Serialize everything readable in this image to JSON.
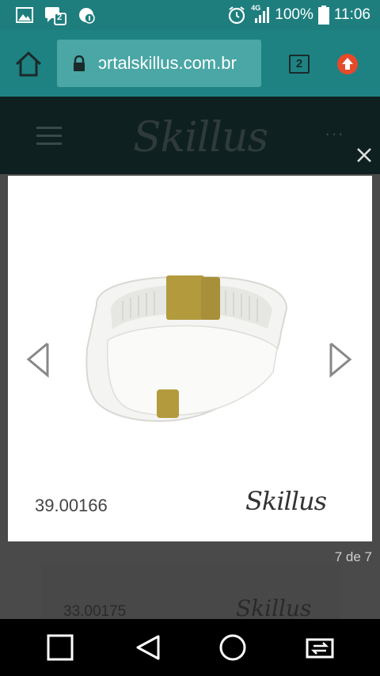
{
  "status_bar": {
    "network": "4G",
    "notification_badge": "2",
    "battery": "100%",
    "time": "11:06",
    "icons": [
      "image-icon",
      "messages-icon",
      "app-update-icon",
      "alarm-icon",
      "signal-icon",
      "battery-icon"
    ]
  },
  "browser": {
    "url": "ɔrtalskillus.com.br",
    "tab_count": "2",
    "icons": [
      "home-icon",
      "lock-icon",
      "tabs-icon",
      "update-icon"
    ]
  },
  "site": {
    "logo": "Skillus",
    "more": "···"
  },
  "lightbox": {
    "product_code": "39.00166",
    "logo": "Skillus",
    "counter": "7 de 7"
  },
  "background_card": {
    "product_code": "33.00175",
    "logo": "Skillus"
  },
  "colors": {
    "status_bar": "#1e7e7e",
    "browser_bar": "#1e8282",
    "url_box": "#4aa7a6",
    "update_badge": "#e64a2a",
    "clasp": "#b39a3d"
  }
}
